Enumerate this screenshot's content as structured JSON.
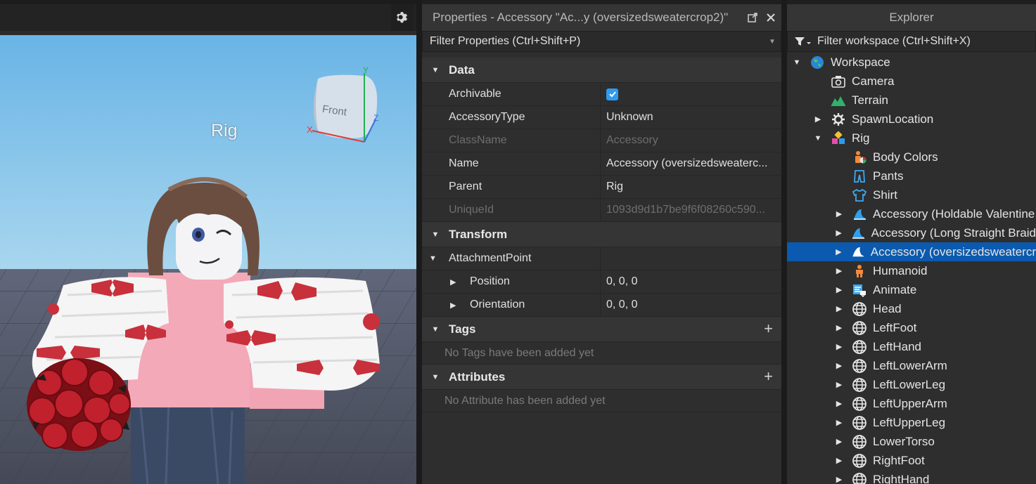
{
  "viewport": {
    "rig_label": "Rig",
    "view_cube_face": "Front",
    "axis_x": "X",
    "axis_y": "Y",
    "axis_z": "Z"
  },
  "properties": {
    "title": "Properties - Accessory \"Ac...y (oversizedsweatercrop2)\"",
    "filter_placeholder": "Filter Properties (Ctrl+Shift+P)",
    "sections": {
      "data": "Data",
      "transform": "Transform",
      "tags": "Tags",
      "attributes": "Attributes"
    },
    "rows": {
      "archivable": {
        "name": "Archivable",
        "checked": true
      },
      "accessory_type": {
        "name": "AccessoryType",
        "value": "Unknown"
      },
      "class_name": {
        "name": "ClassName",
        "value": "Accessory"
      },
      "name": {
        "name": "Name",
        "value": "Accessory (oversizedsweaterc..."
      },
      "parent": {
        "name": "Parent",
        "value": "Rig"
      },
      "unique_id": {
        "name": "UniqueId",
        "value": "1093d9d1b7be9f6f08260c590..."
      },
      "attachment_point": {
        "name": "AttachmentPoint",
        "value": ""
      },
      "position": {
        "name": "Position",
        "value": "0, 0, 0"
      },
      "orientation": {
        "name": "Orientation",
        "value": "0, 0, 0"
      }
    },
    "tags_empty": "No Tags have been added yet",
    "attributes_empty": "No Attribute has been added yet"
  },
  "explorer": {
    "title": "Explorer",
    "filter_placeholder": "Filter workspace (Ctrl+Shift+X)",
    "items": [
      {
        "label": "Workspace",
        "icon": "workspace-icon",
        "level": 0,
        "arrow": "expanded"
      },
      {
        "label": "Camera",
        "icon": "camera-icon",
        "level": 1,
        "arrow": "none"
      },
      {
        "label": "Terrain",
        "icon": "terrain-icon",
        "level": 1,
        "arrow": "none"
      },
      {
        "label": "SpawnLocation",
        "icon": "spawnlocation-icon",
        "level": 1,
        "arrow": "collapsed"
      },
      {
        "label": "Rig",
        "icon": "model-icon",
        "level": 1,
        "arrow": "expanded"
      },
      {
        "label": "Body Colors",
        "icon": "body-colors-icon",
        "level": 2,
        "arrow": "none"
      },
      {
        "label": "Pants",
        "icon": "pants-icon",
        "level": 2,
        "arrow": "none"
      },
      {
        "label": "Shirt",
        "icon": "shirt-icon",
        "level": 2,
        "arrow": "none"
      },
      {
        "label": "Accessory (Holdable Valentine",
        "icon": "accessory-icon",
        "level": 2,
        "arrow": "collapsed"
      },
      {
        "label": "Accessory (Long Straight Braid",
        "icon": "accessory-icon",
        "level": 2,
        "arrow": "collapsed"
      },
      {
        "label": "Accessory (oversizedsweatercr",
        "icon": "accessory-icon",
        "level": 2,
        "arrow": "collapsed",
        "selected": true
      },
      {
        "label": "Humanoid",
        "icon": "humanoid-icon",
        "level": 2,
        "arrow": "collapsed"
      },
      {
        "label": "Animate",
        "icon": "script-icon",
        "level": 2,
        "arrow": "collapsed"
      },
      {
        "label": "Head",
        "icon": "meshpart-icon",
        "level": 2,
        "arrow": "collapsed"
      },
      {
        "label": "LeftFoot",
        "icon": "meshpart-icon",
        "level": 2,
        "arrow": "collapsed"
      },
      {
        "label": "LeftHand",
        "icon": "meshpart-icon",
        "level": 2,
        "arrow": "collapsed"
      },
      {
        "label": "LeftLowerArm",
        "icon": "meshpart-icon",
        "level": 2,
        "arrow": "collapsed"
      },
      {
        "label": "LeftLowerLeg",
        "icon": "meshpart-icon",
        "level": 2,
        "arrow": "collapsed"
      },
      {
        "label": "LeftUpperArm",
        "icon": "meshpart-icon",
        "level": 2,
        "arrow": "collapsed"
      },
      {
        "label": "LeftUpperLeg",
        "icon": "meshpart-icon",
        "level": 2,
        "arrow": "collapsed"
      },
      {
        "label": "LowerTorso",
        "icon": "meshpart-icon",
        "level": 2,
        "arrow": "collapsed"
      },
      {
        "label": "RightFoot",
        "icon": "meshpart-icon",
        "level": 2,
        "arrow": "collapsed"
      },
      {
        "label": "RightHand",
        "icon": "meshpart-icon",
        "level": 2,
        "arrow": "collapsed"
      }
    ]
  },
  "colors": {
    "selection": "#0b5aaf",
    "checkbox": "#2d9cf0",
    "sky": "#7ec3ea",
    "baseplate": "#4f5361",
    "sweater": "#f3a9b8",
    "bow": "#c8303c"
  }
}
